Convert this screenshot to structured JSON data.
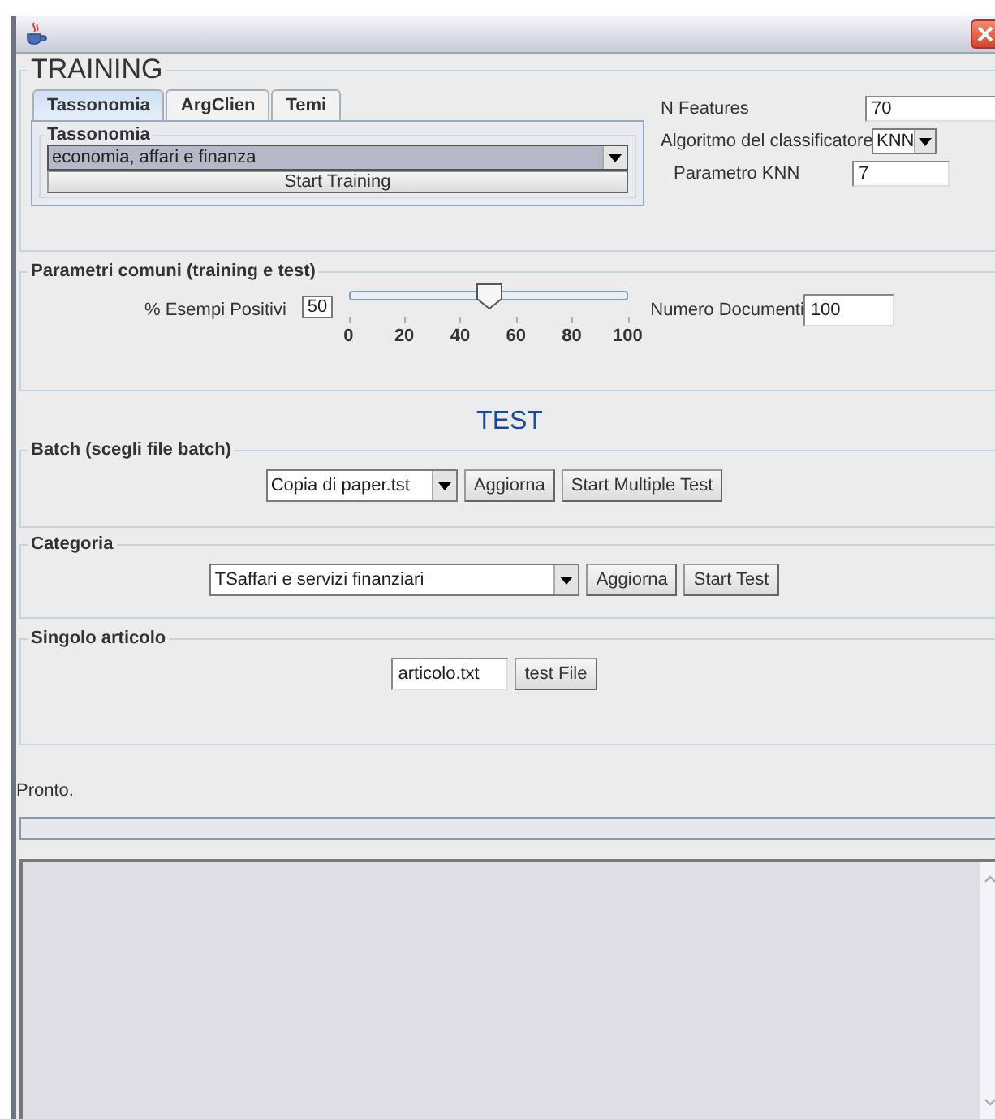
{
  "training": {
    "title": "TRAINING",
    "tabs": [
      {
        "label": "Tassonomia",
        "selected": true
      },
      {
        "label": "ArgClien",
        "selected": false
      },
      {
        "label": "Temi",
        "selected": false
      }
    ],
    "taxonomy": {
      "legend": "Tassonomia",
      "value": "economia, affari e finanza",
      "button": "Start Training"
    },
    "params": [
      {
        "kind": "field",
        "label": "N Features",
        "value": "70"
      },
      {
        "kind": "select",
        "label": "Algoritmo del classificatore",
        "value": "KNN"
      },
      {
        "kind": "field",
        "label": "Parametro KNN",
        "value": "7"
      }
    ]
  },
  "common": {
    "legend": "Parametri comuni (training e test)",
    "positive_label": "% Esempi Positivi",
    "positive_value": "50",
    "level": 0.5,
    "ticks": [
      "0",
      "20",
      "40",
      "60",
      "80",
      "100"
    ],
    "docs_label": "Numero Documenti",
    "docs_value": "100"
  },
  "test_title": "TEST",
  "batch": {
    "legend": "Batch (scegli file batch)",
    "value": "Copia di paper.tst",
    "buttons": [
      "Aggiorna",
      "Start Multiple Test"
    ]
  },
  "category": {
    "legend": "Categoria",
    "value": "TSaffari e servizi finanziari",
    "buttons": [
      "Aggiorna",
      "Start Test"
    ]
  },
  "single": {
    "legend": "Singolo articolo",
    "value": "articolo.txt",
    "button": "test File"
  },
  "status": "Pronto."
}
